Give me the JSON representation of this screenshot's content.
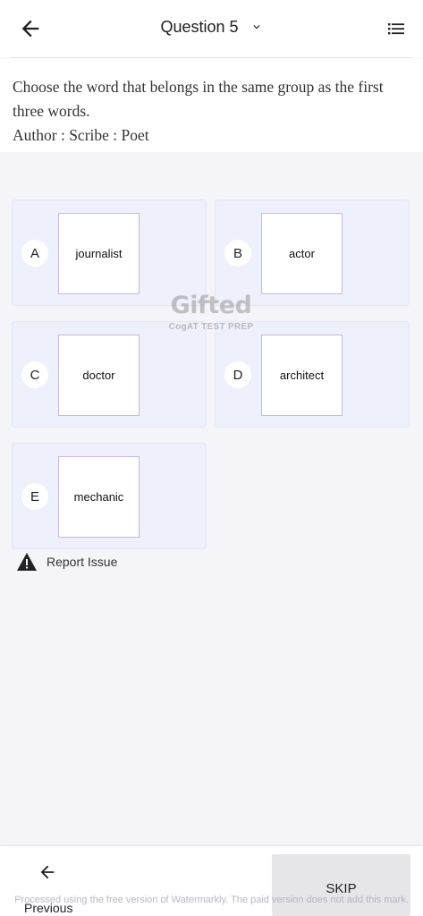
{
  "header": {
    "title": "Question 5",
    "back_icon": "arrow-left-icon",
    "dropdown_icon": "chevron-down-icon",
    "menu_icon": "list-icon"
  },
  "question": {
    "line1": "Choose the word that belongs in the same group as the first three words.",
    "line2": "Author : Scribe : Poet"
  },
  "options": [
    {
      "letter": "A",
      "word": "journalist"
    },
    {
      "letter": "B",
      "word": "actor"
    },
    {
      "letter": "C",
      "word": "doctor"
    },
    {
      "letter": "D",
      "word": "architect"
    },
    {
      "letter": "E",
      "word": "mechanic"
    }
  ],
  "watermark": {
    "brand": "Gifted",
    "tagline": "CogAT TEST PREP"
  },
  "report": {
    "label": "Report Issue",
    "icon": "warning-icon"
  },
  "footer": {
    "previous_label": "Previous",
    "skip_label": "SKIP",
    "notice": "Processed using the free version of Watermarkly. The paid version does not add this mark."
  },
  "colors": {
    "option_bg": "#eef0fc",
    "card_border": "#c9b8d8",
    "page_bg": "#f5f5f9"
  }
}
